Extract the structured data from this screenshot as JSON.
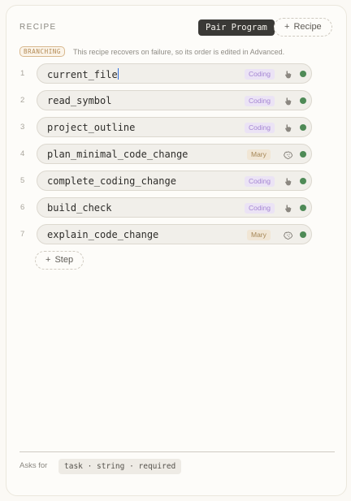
{
  "header": {
    "label": "RECIPE",
    "recipe_name": "Pair Program",
    "add_recipe_label": "Recipe"
  },
  "branching": {
    "badge": "BRANCHING",
    "note": "This recipe recovers on failure, so its order is edited in Advanced."
  },
  "steps": [
    {
      "num": "1",
      "name": "current_file",
      "tag": "Coding",
      "action_icon": "pointer-hand-icon",
      "status_color": "#4e8a56"
    },
    {
      "num": "2",
      "name": "read_symbol",
      "tag": "Coding",
      "action_icon": "pointer-hand-icon",
      "status_color": "#4e8a56"
    },
    {
      "num": "3",
      "name": "project_outline",
      "tag": "Coding",
      "action_icon": "pointer-hand-icon",
      "status_color": "#4e8a56"
    },
    {
      "num": "4",
      "name": "plan_minimal_code_change",
      "tag": "Mary",
      "action_icon": "brain-icon",
      "status_color": "#4e8a56"
    },
    {
      "num": "5",
      "name": "complete_coding_change",
      "tag": "Coding",
      "action_icon": "pointer-hand-icon",
      "status_color": "#4e8a56"
    },
    {
      "num": "6",
      "name": "build_check",
      "tag": "Coding",
      "action_icon": "pointer-hand-icon",
      "status_color": "#4e8a56"
    },
    {
      "num": "7",
      "name": "explain_code_change",
      "tag": "Mary",
      "action_icon": "brain-icon",
      "status_color": "#4e8a56"
    }
  ],
  "add_step_label": "Step",
  "footer": {
    "asks_for_label": "Asks for",
    "signature": "task · string · required"
  },
  "colors": {
    "coding_tag_bg": "#ebe3f5",
    "coding_tag_fg": "#a586d3",
    "mary_tag_bg": "#f1e6d5",
    "mary_tag_fg": "#a58757",
    "status_ok": "#4e8a56",
    "caret": "#2f6fe0"
  }
}
